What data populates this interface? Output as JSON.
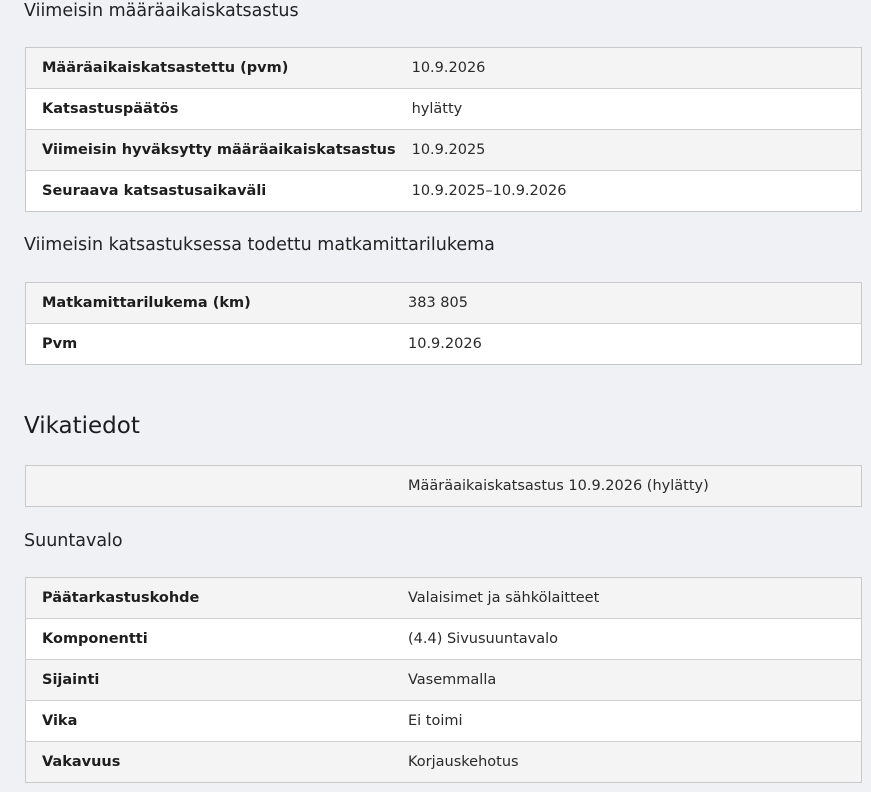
{
  "inspection": {
    "heading": "Viimeisin määräaikaiskatsastus",
    "rows": [
      {
        "label": "Määräaikaiskatsastettu (pvm)",
        "value": "10.9.2026"
      },
      {
        "label": "Katsastuspäätös",
        "value": "hylätty"
      },
      {
        "label": "Viimeisin hyväksytty määräaikaiskatsastus",
        "value": "10.9.2025"
      },
      {
        "label": "Seuraava katsastusaikaväli",
        "value": "10.9.2025–10.9.2026"
      }
    ]
  },
  "odometer": {
    "heading": "Viimeisin katsastuksessa todettu matkamittarilukema",
    "rows": [
      {
        "label": "Matkamittarilukema (km)",
        "value": "383 805"
      },
      {
        "label": "Pvm",
        "value": "10.9.2026"
      }
    ]
  },
  "defects": {
    "heading": "Vikatiedot",
    "summary": {
      "label": "",
      "value": "Määräaikaiskatsastus 10.9.2026 (hylätty)"
    },
    "group_heading": "Suuntavalo",
    "rows": [
      {
        "label": "Päätarkastuskohde",
        "value": "Valaisimet ja sähkölaitteet"
      },
      {
        "label": "Komponentti",
        "value": "(4.4) Sivusuuntavalo"
      },
      {
        "label": "Sijainti",
        "value": "Vasemmalla"
      },
      {
        "label": "Vika",
        "value": "Ei toimi"
      },
      {
        "label": "Vakavuus",
        "value": "Korjauskehotus"
      }
    ]
  }
}
